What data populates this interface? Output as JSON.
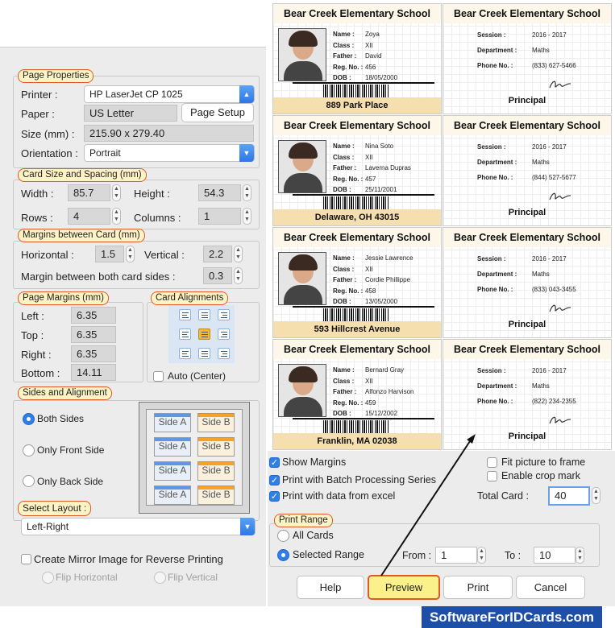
{
  "page_properties": {
    "legend": "Page Properties",
    "printer_label": "Printer :",
    "printer_value": "HP LaserJet CP 1025",
    "paper_label": "Paper :",
    "paper_value": "US Letter",
    "page_setup_button": "Page Setup",
    "size_label": "Size (mm) :",
    "size_value": "215.90 x 279.40",
    "orientation_label": "Orientation :",
    "orientation_value": "Portrait"
  },
  "card_size": {
    "legend": "Card Size and Spacing (mm)",
    "width_label": "Width :",
    "width_value": "85.7",
    "height_label": "Height :",
    "height_value": "54.3",
    "rows_label": "Rows :",
    "rows_value": "4",
    "columns_label": "Columns :",
    "columns_value": "1"
  },
  "margins_card": {
    "legend": "Margins between Card (mm)",
    "horizontal_label": "Horizontal :",
    "horizontal_value": "1.5",
    "vertical_label": "Vertical :",
    "vertical_value": "2.2",
    "both_sides_label": "Margin between both card sides :",
    "both_sides_value": "0.3"
  },
  "page_margins": {
    "legend": "Page Margins (mm)",
    "left_label": "Left :",
    "left_value": "6.35",
    "top_label": "Top :",
    "top_value": "6.35",
    "right_label": "Right :",
    "right_value": "6.35",
    "bottom_label": "Bottom :",
    "bottom_value": "14.11"
  },
  "card_alignments": {
    "legend": "Card Alignments",
    "auto_center_label": "Auto (Center)"
  },
  "sides_alignment": {
    "legend": "Sides and Alignment",
    "both_sides": "Both Sides",
    "front_side": "Only Front Side",
    "back_side": "Only Back Side",
    "side_a": "Side A",
    "side_b": "Side B"
  },
  "select_layout": {
    "legend": "Select Layout :",
    "value": "Left-Right"
  },
  "mirror": {
    "label": "Create Mirror Image for Reverse Printing",
    "flip_horizontal": "Flip Horizontal",
    "flip_vertical": "Flip Vertical"
  },
  "cards": [
    {
      "school": "Bear Creek Elementary School",
      "name": "Zoya",
      "class": "XII",
      "father": "David",
      "reg": "456",
      "dob": "18/05/2000",
      "address": "889 Park Place",
      "session": "2016 - 2017",
      "department": "Maths",
      "phone": "(833) 627-5466"
    },
    {
      "school": "Bear Creek Elementary School",
      "name": "Nina Soto",
      "class": "XII",
      "father": "Laverna Dupras",
      "reg": "457",
      "dob": "25/11/2001",
      "address": "Delaware, OH 43015",
      "session": "2016 - 2017",
      "department": "Maths",
      "phone": "(844) 527-5677"
    },
    {
      "school": "Bear Creek Elementary School",
      "name": "Jessie Lawrence",
      "class": "XII",
      "father": "Cordie Phillippe",
      "reg": "458",
      "dob": "13/05/2000",
      "address": "593 Hillcrest Avenue",
      "session": "2016 - 2017",
      "department": "Maths",
      "phone": "(833) 043-3455"
    },
    {
      "school": "Bear Creek Elementary School",
      "name": "Bernard Gray",
      "class": "XII",
      "father": "Alfonzo Harvison",
      "reg": "459",
      "dob": "15/12/2002",
      "address": "Franklin, MA 02038",
      "session": "2016 - 2017",
      "department": "Maths",
      "phone": "(822) 234-2355"
    }
  ],
  "card_labels": {
    "name": "Name :",
    "class": "Class :",
    "father": "Father :",
    "reg": "Reg. No. :",
    "dob": "DOB :",
    "session": "Session :",
    "department": "Department :",
    "phone": "Phone No. :",
    "principal": "Principal"
  },
  "options": {
    "show_margins": "Show Margins",
    "batch": "Print with Batch Processing Series",
    "excel": "Print with data from excel",
    "fit_picture": "Fit picture to frame",
    "crop_mark": "Enable crop mark",
    "total_card_label": "Total Card :",
    "total_card_value": "40"
  },
  "print_range": {
    "legend": "Print Range",
    "all_cards": "All Cards",
    "selected_range": "Selected Range",
    "from_label": "From :",
    "from_value": "1",
    "to_label": "To :",
    "to_value": "10"
  },
  "buttons": {
    "help": "Help",
    "preview": "Preview",
    "print": "Print",
    "cancel": "Cancel"
  },
  "watermark": "SoftwareForIDCards.com"
}
